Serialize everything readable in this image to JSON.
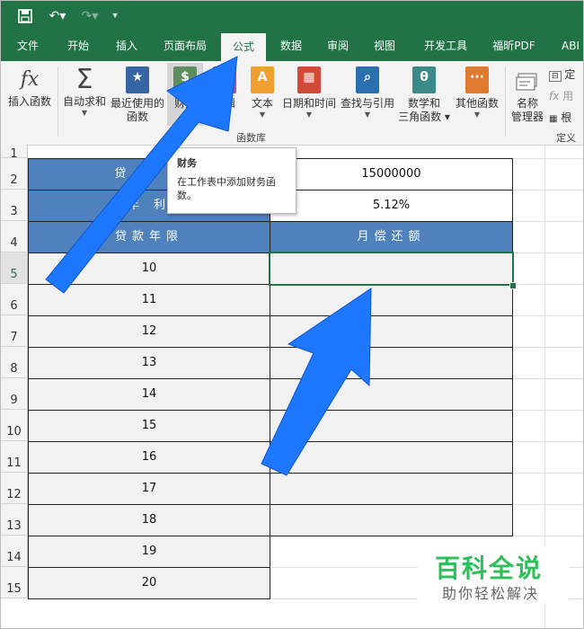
{
  "qat": {
    "save_icon": "save-icon",
    "undo_label": "↶▾",
    "redo_label": "↷▾",
    "customize_label": "▾"
  },
  "tabs": [
    "文件",
    "开始",
    "插入",
    "页面布局",
    "公式",
    "数据",
    "审阅",
    "视图",
    "开发工具",
    "福昕PDF",
    "ABI"
  ],
  "active_tab": "公式",
  "ribbon": {
    "insert_function": {
      "icon": "fx",
      "label": "插入函数"
    },
    "autosum": {
      "icon": "Σ",
      "label": "自动求和"
    },
    "recent": {
      "label1": "最近使用的",
      "label2": "函数"
    },
    "financial": {
      "label": "财务"
    },
    "logical": {
      "label": "逻辑"
    },
    "text": {
      "icon": "A",
      "label": "文本"
    },
    "datetime": {
      "label": "日期和时间"
    },
    "lookup": {
      "label": "查找与引用"
    },
    "math": {
      "icon": "θ",
      "label1": "数学和",
      "label2": "三角函数"
    },
    "more": {
      "icon": "···",
      "label": "其他函数"
    },
    "name_manager": {
      "label1": "名称",
      "label2": "管理器"
    },
    "define_name": "定",
    "use_in_formula": "用",
    "create_from_selection": "根",
    "group_function_library": "函数库",
    "group_defined_names": "定义"
  },
  "tooltip": {
    "title": "财务",
    "description": "在工作表中添加财务函数。"
  },
  "rows": [
    "1",
    "2",
    "3",
    "4",
    "5",
    "6",
    "7",
    "8",
    "9",
    "10",
    "11",
    "12",
    "13",
    "14",
    "15"
  ],
  "table": {
    "loan_amount_label": "贷 款 金",
    "loan_amount_value": "15000000",
    "rate_label": "年 利",
    "rate_value": "5.12%",
    "col_years": "贷款年限",
    "col_monthly": "月偿还额",
    "years": [
      "10",
      "11",
      "12",
      "13",
      "14",
      "15",
      "16",
      "17",
      "18",
      "19",
      "20"
    ]
  },
  "watermark": {
    "title": "百科全说",
    "subtitle": "助你轻松解决"
  },
  "colors": {
    "excel_green": "#217346",
    "header_blue": "#4f81bd",
    "arrow_blue": "#1e78ff",
    "watermark_green": "#2fbf5a"
  }
}
